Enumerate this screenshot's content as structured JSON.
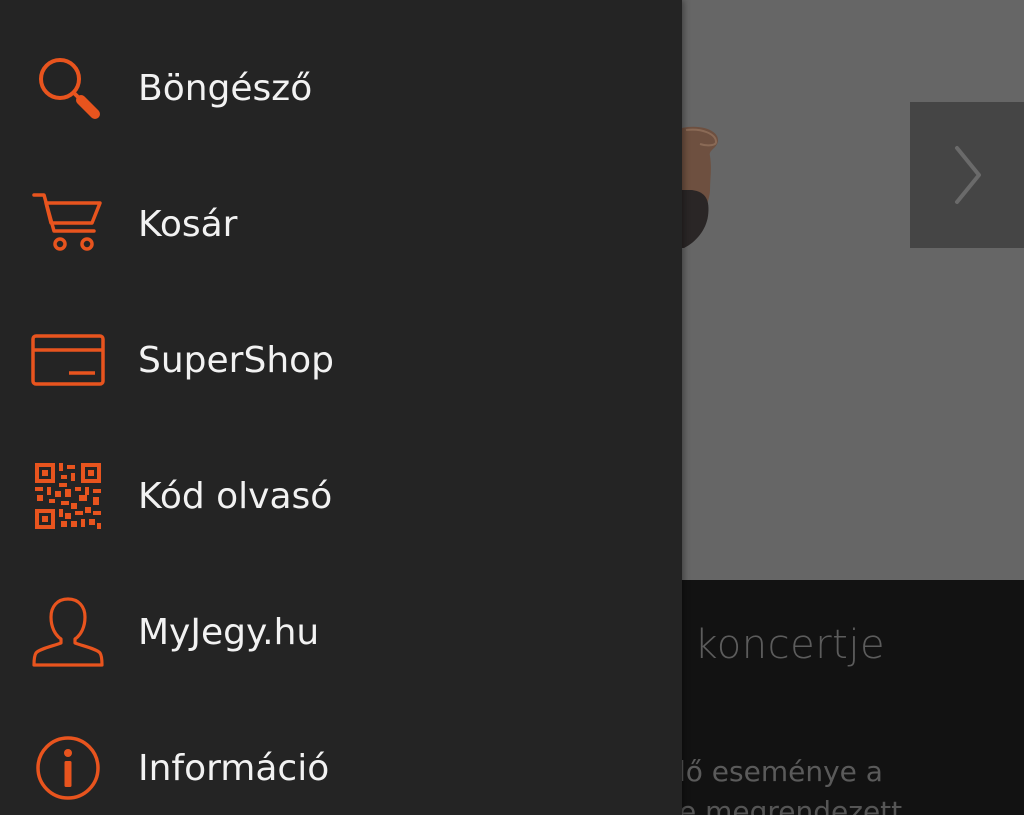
{
  "theme": {
    "accent": "#e8541e",
    "drawer_bg": "#242424",
    "text": "#f2f2f2"
  },
  "drawer": {
    "items": [
      {
        "label": "Böngésző",
        "icon": "search-icon"
      },
      {
        "label": "Kosár",
        "icon": "cart-icon"
      },
      {
        "label": "SuperShop",
        "icon": "card-icon"
      },
      {
        "label": "Kód olvasó",
        "icon": "qr-code-icon"
      },
      {
        "label": "MyJegy.hu",
        "icon": "user-icon"
      },
      {
        "label": "Információ",
        "icon": "info-icon"
      }
    ]
  },
  "background": {
    "next_icon": "chevron-right-icon",
    "title_fragment": "s koncertje",
    "desc_line1": "dő eseménye a",
    "desc_line2": "te megrendezett"
  }
}
